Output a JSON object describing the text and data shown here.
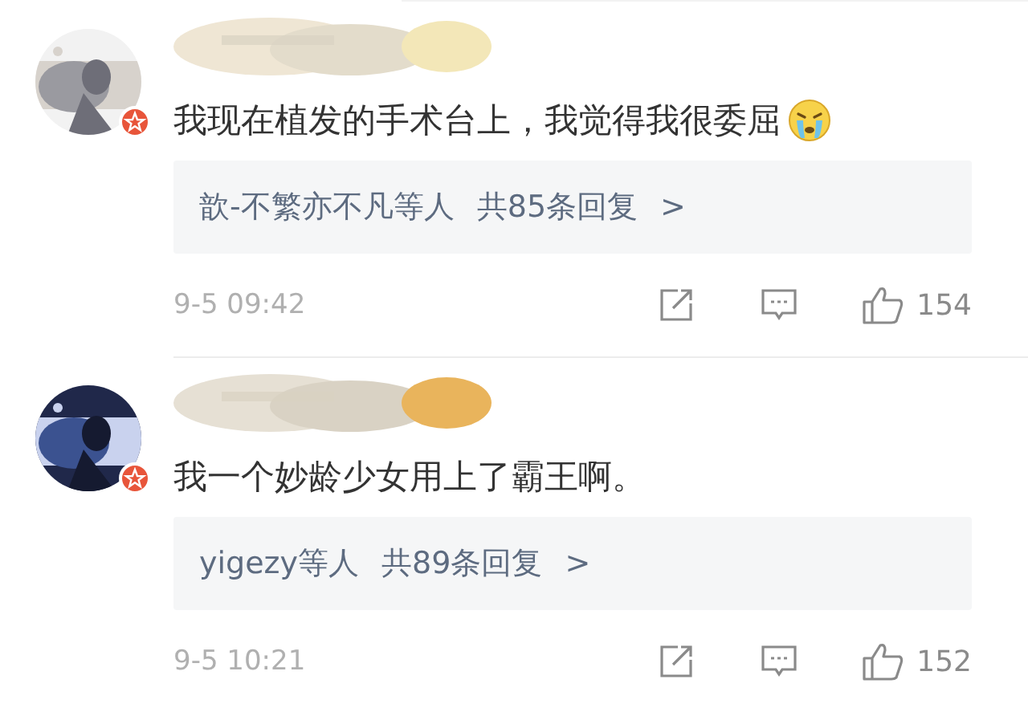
{
  "comments": [
    {
      "text": "我现在植发的手术台上，我觉得我很委屈",
      "emoji": true,
      "reply_users": "歆-不繁亦不凡等人",
      "reply_count": "共85条回复",
      "reply_arrow": ">",
      "time": "9-5 09:42",
      "likes": "154"
    },
    {
      "text": "我一个妙龄少女用上了霸王啊。",
      "emoji": false,
      "reply_users": "yigezy等人",
      "reply_count": "共89条回复",
      "reply_arrow": ">",
      "time": "9-5 10:21",
      "likes": "152"
    }
  ]
}
